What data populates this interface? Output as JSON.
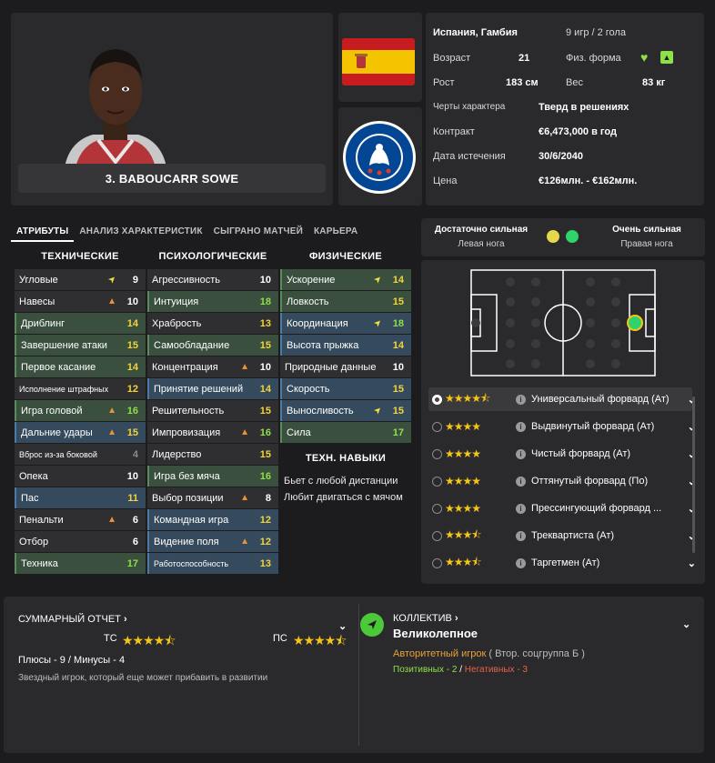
{
  "player": {
    "name": "3. BABOUCARR SOWE",
    "nationality": "Испания, Гамбия",
    "caps": "9 игр / 2 гола",
    "age_label": "Возраст",
    "age": "21",
    "fitness_label": "Физ. форма",
    "height_label": "Рост",
    "height": "183 см",
    "weight_label": "Вес",
    "weight": "83 кг",
    "traits_label": "Черты характера",
    "traits": "Тверд в решениях",
    "contract_label": "Контракт",
    "contract": "€6,473,000 в год",
    "expiry_label": "Дата истечения",
    "expiry": "30/6/2040",
    "price_label": "Цена",
    "price": "€126млн. - €162млн."
  },
  "club_crest_text": "CHELSEA FOOTBALL CLUB",
  "tabs": [
    "АТРИБУТЫ",
    "АНАЛИЗ ХАРАКТЕРИСТИК",
    "СЫГРАНО МАТЧЕЙ",
    "КАРЬЕРА"
  ],
  "columns": {
    "technical": "ТЕХНИЧЕСКИЕ",
    "mental": "ПСИХОЛОГИЧЕСКИЕ",
    "physical": "ФИЗИЧЕСКИЕ",
    "skills": "ТЕХН. НАВЫКИ"
  },
  "technical": [
    {
      "name": "Угловые",
      "value": "9",
      "arrow": "up"
    },
    {
      "name": "Навесы",
      "value": "10",
      "arrow": "down"
    },
    {
      "name": "Дриблинг",
      "value": "14",
      "arrow": ""
    },
    {
      "name": "Завершение атаки",
      "value": "15",
      "arrow": ""
    },
    {
      "name": "Первое касание",
      "value": "14",
      "arrow": ""
    },
    {
      "name": "Исполнение штрафных",
      "value": "12",
      "arrow": ""
    },
    {
      "name": "Игра головой",
      "value": "16",
      "arrow": "down"
    },
    {
      "name": "Дальние удары",
      "value": "15",
      "arrow": "down"
    },
    {
      "name": "Вброс из-за боковой",
      "value": "4",
      "arrow": ""
    },
    {
      "name": "Опека",
      "value": "10",
      "arrow": ""
    },
    {
      "name": "Пас",
      "value": "11",
      "arrow": ""
    },
    {
      "name": "Пенальти",
      "value": "6",
      "arrow": "down"
    },
    {
      "name": "Отбор",
      "value": "6",
      "arrow": ""
    },
    {
      "name": "Техника",
      "value": "17",
      "arrow": ""
    }
  ],
  "mental": [
    {
      "name": "Агрессивность",
      "value": "10",
      "arrow": ""
    },
    {
      "name": "Интуиция",
      "value": "18",
      "arrow": ""
    },
    {
      "name": "Храбрость",
      "value": "13",
      "arrow": ""
    },
    {
      "name": "Самообладание",
      "value": "15",
      "arrow": ""
    },
    {
      "name": "Концентрация",
      "value": "10",
      "arrow": "down"
    },
    {
      "name": "Принятие решений",
      "value": "14",
      "arrow": ""
    },
    {
      "name": "Решительность",
      "value": "15",
      "arrow": ""
    },
    {
      "name": "Импровизация",
      "value": "16",
      "arrow": "down"
    },
    {
      "name": "Лидерство",
      "value": "15",
      "arrow": ""
    },
    {
      "name": "Игра без мяча",
      "value": "16",
      "arrow": ""
    },
    {
      "name": "Выбор позиции",
      "value": "8",
      "arrow": "down"
    },
    {
      "name": "Командная игра",
      "value": "12",
      "arrow": ""
    },
    {
      "name": "Видение поля",
      "value": "12",
      "arrow": "down"
    },
    {
      "name": "Работоспособность",
      "value": "13",
      "arrow": ""
    }
  ],
  "physical": [
    {
      "name": "Ускорение",
      "value": "14",
      "arrow": "up"
    },
    {
      "name": "Ловкость",
      "value": "15",
      "arrow": ""
    },
    {
      "name": "Координация",
      "value": "18",
      "arrow": "up"
    },
    {
      "name": "Высота прыжка",
      "value": "14",
      "arrow": ""
    },
    {
      "name": "Природные данные",
      "value": "10",
      "arrow": ""
    },
    {
      "name": "Скорость",
      "value": "15",
      "arrow": ""
    },
    {
      "name": "Выносливость",
      "value": "15",
      "arrow": "up"
    },
    {
      "name": "Сила",
      "value": "17",
      "arrow": ""
    }
  ],
  "skills_text": [
    "Бьет с любой дистанции",
    "Любит двигаться с мячом"
  ],
  "feet": {
    "left_rating": "Достаточно сильная",
    "left_label": "Левая нога",
    "right_rating": "Очень сильная",
    "right_label": "Правая нога",
    "left_color": "#e5d84a",
    "right_color": "#2ed46a"
  },
  "roles": [
    {
      "name": "Универсальный форвард (Ат)",
      "stars": 4.5,
      "selected": true
    },
    {
      "name": "Выдвинутый форвард (Ат)",
      "stars": 4,
      "selected": false
    },
    {
      "name": "Чистый форвард (Ат)",
      "stars": 4,
      "selected": false
    },
    {
      "name": "Оттянутый форвард (По)",
      "stars": 4,
      "selected": false
    },
    {
      "name": "Прессингующий форвард ...",
      "stars": 4,
      "selected": false
    },
    {
      "name": "Треквартиста (Ат)",
      "stars": 3.5,
      "selected": false
    },
    {
      "name": "Таргетмен (Ат)",
      "stars": 3.5,
      "selected": false
    }
  ],
  "summary": {
    "title": "СУММАРНЫЙ ОТЧЕТ",
    "ts_label": "ТС",
    "ts_stars": 4.5,
    "ps_label": "ПС",
    "ps_stars": 4.5,
    "pros_cons": "Плюсы - 9 / Минусы - 4",
    "desc": "Звездный игрок, который еще может прибавить в развитии"
  },
  "collective": {
    "title": "КОЛЛЕКТИВ",
    "value": "Великолепное",
    "role": "Авторитетный игрок",
    "group": "( Втор. соцгруппа Б )",
    "positive": "Позитивных - 2",
    "sep": "/",
    "negative": "Негативных - 3"
  },
  "colors": {
    "accent_green": "#8ee04a",
    "accent_yellow": "#f2d43a",
    "arrow_orange": "#e8933a",
    "negative_red": "#e8604a",
    "star": "#f5c518"
  }
}
